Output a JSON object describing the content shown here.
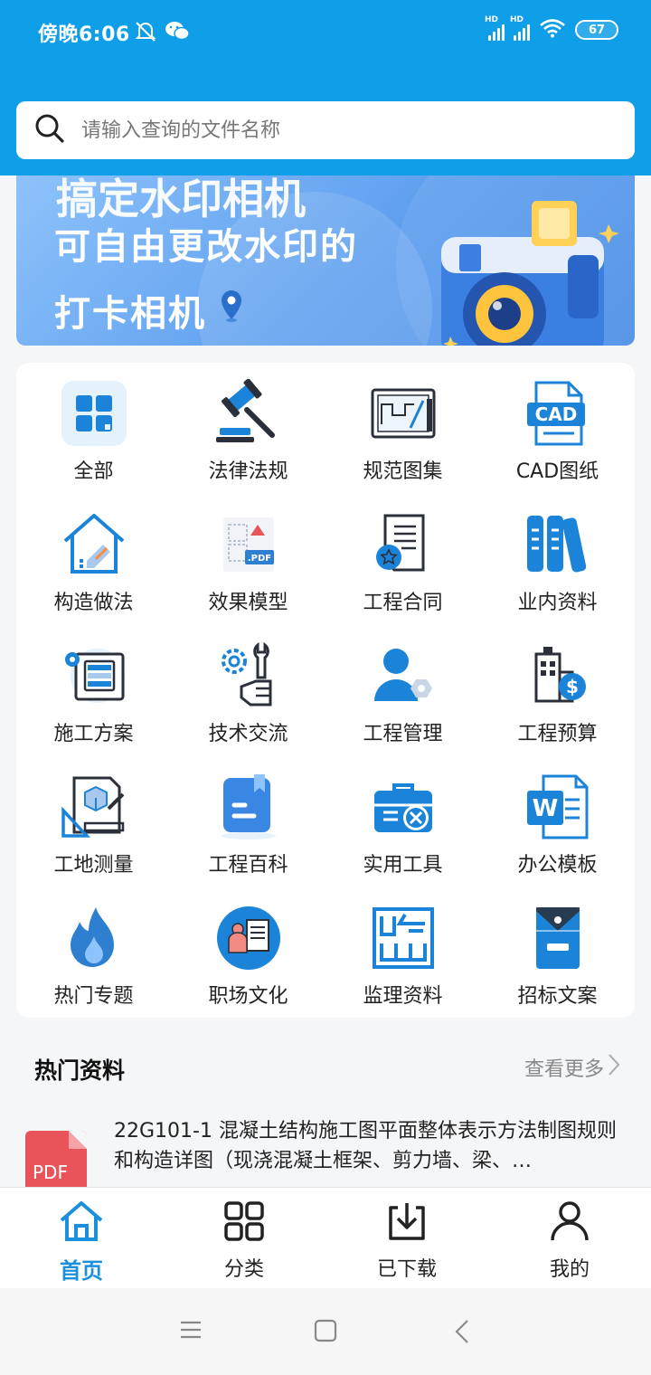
{
  "status_bar": {
    "time": "傍晚6:06",
    "battery": "67",
    "signal_label_1": "HD",
    "signal_label_2": "HD"
  },
  "search": {
    "placeholder": "请输入查询的文件名称"
  },
  "banner": {
    "cut_text": "搞定水印相机",
    "line1": "可自由更改水印的",
    "line2": "打卡相机"
  },
  "categories": [
    {
      "label": "全部",
      "icon": "grid-icon"
    },
    {
      "label": "法律法规",
      "icon": "gavel-icon"
    },
    {
      "label": "规范图集",
      "icon": "drawing-icon"
    },
    {
      "label": "CAD图纸",
      "icon": "cad-file-icon"
    },
    {
      "label": "构造做法",
      "icon": "house-icon"
    },
    {
      "label": "效果模型",
      "icon": "pdf-model-icon"
    },
    {
      "label": "工程合同",
      "icon": "contract-icon"
    },
    {
      "label": "业内资料",
      "icon": "books-icon"
    },
    {
      "label": "施工方案",
      "icon": "plan-board-icon"
    },
    {
      "label": "技术交流",
      "icon": "wrench-hand-icon"
    },
    {
      "label": "工程管理",
      "icon": "manager-icon"
    },
    {
      "label": "工程预算",
      "icon": "budget-icon"
    },
    {
      "label": "工地测量",
      "icon": "measure-icon"
    },
    {
      "label": "工程百科",
      "icon": "encyclopedia-icon"
    },
    {
      "label": "实用工具",
      "icon": "toolbox-icon"
    },
    {
      "label": "办公模板",
      "icon": "word-icon"
    },
    {
      "label": "热门专题",
      "icon": "fire-icon"
    },
    {
      "label": "职场文化",
      "icon": "workplace-icon"
    },
    {
      "label": "监理资料",
      "icon": "supervision-icon"
    },
    {
      "label": "招标文案",
      "icon": "envelope-icon"
    }
  ],
  "hot": {
    "title": "热门资料",
    "more": "查看更多",
    "items": [
      {
        "badge": "PDF",
        "title": "22G101-1 混凝土结构施工图平面整体表示方法制图规则和构造详图（现浇混凝土框架、剪力墙、梁、…"
      }
    ]
  },
  "nav": [
    {
      "label": "首页",
      "icon": "home-icon",
      "active": true
    },
    {
      "label": "分类",
      "icon": "category-icon",
      "active": false
    },
    {
      "label": "已下载",
      "icon": "download-icon",
      "active": false
    },
    {
      "label": "我的",
      "icon": "user-icon",
      "active": false
    }
  ],
  "colors": {
    "primary": "#0f9ee8",
    "accent_blue": "#1a8fdc",
    "icon_dark": "#2a2f3a",
    "pdf_red": "#e9535a"
  }
}
